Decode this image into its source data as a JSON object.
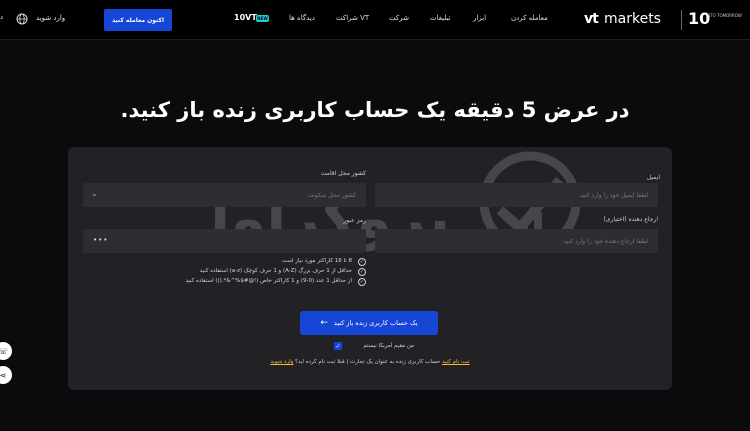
{
  "nav": {
    "cta_label": "اکنون معامله کنید",
    "login_label": "وارد شوید",
    "edge_label": "د",
    "vt10_label": "10VT",
    "new_badge": "NEW",
    "items": [
      "دیدگاه ها",
      "شراکت VT",
      "شرکت",
      "تبلیغات",
      "ابزار",
      "معامله کردن"
    ],
    "logo_mark": "vt",
    "logo_text": "markets",
    "ten_label": "10",
    "tagline": "INTO TOMORROW"
  },
  "heading": "در عرض 5 دقیقه یک حساب کاربری زنده باز کنید.",
  "form": {
    "email_label": "ایمیل",
    "email_placeholder": "لطفا ایمیل خود را وارد کنید",
    "country_label": "کشور محل اقامت",
    "country_placeholder": "کشور محل سکونت",
    "referral_label": "ارجاع دهنده (اختیاری)",
    "referral_placeholder": "لطفا ارجاع دهنده خود را وارد کنید",
    "password_label": "رمز عبور",
    "password_value": "•••",
    "rules": [
      "8 تا 16 کاراکتر مورد نیاز است",
      "حداقل از 1 حرف بزرگ (A-Z) و 1 حرف کوچک (a-z) استفاده کنید",
      "از حداقل 1 عدد (0-9) و 1 کاراکتر خاص (!@#$%^&*.()) استفاده کنید"
    ],
    "submit_label": "یک حساب کاربری زنده باز کنید",
    "us_resident_label": "من مقیم آمریکا نیستم",
    "footer_text": "حساب کاربری زنده به عنوان یک تجارت | قبلا ثبت نام کرده اید؟",
    "footer_link_register": "ثبت نام کنید",
    "footer_link_login": "وارد شوید"
  },
  "watermark_text": "بروکراول",
  "colors": {
    "accent": "#1546d6",
    "background": "#0b0b0d",
    "card": "#222226",
    "field": "#2d2d32",
    "link": "#f0c030"
  }
}
